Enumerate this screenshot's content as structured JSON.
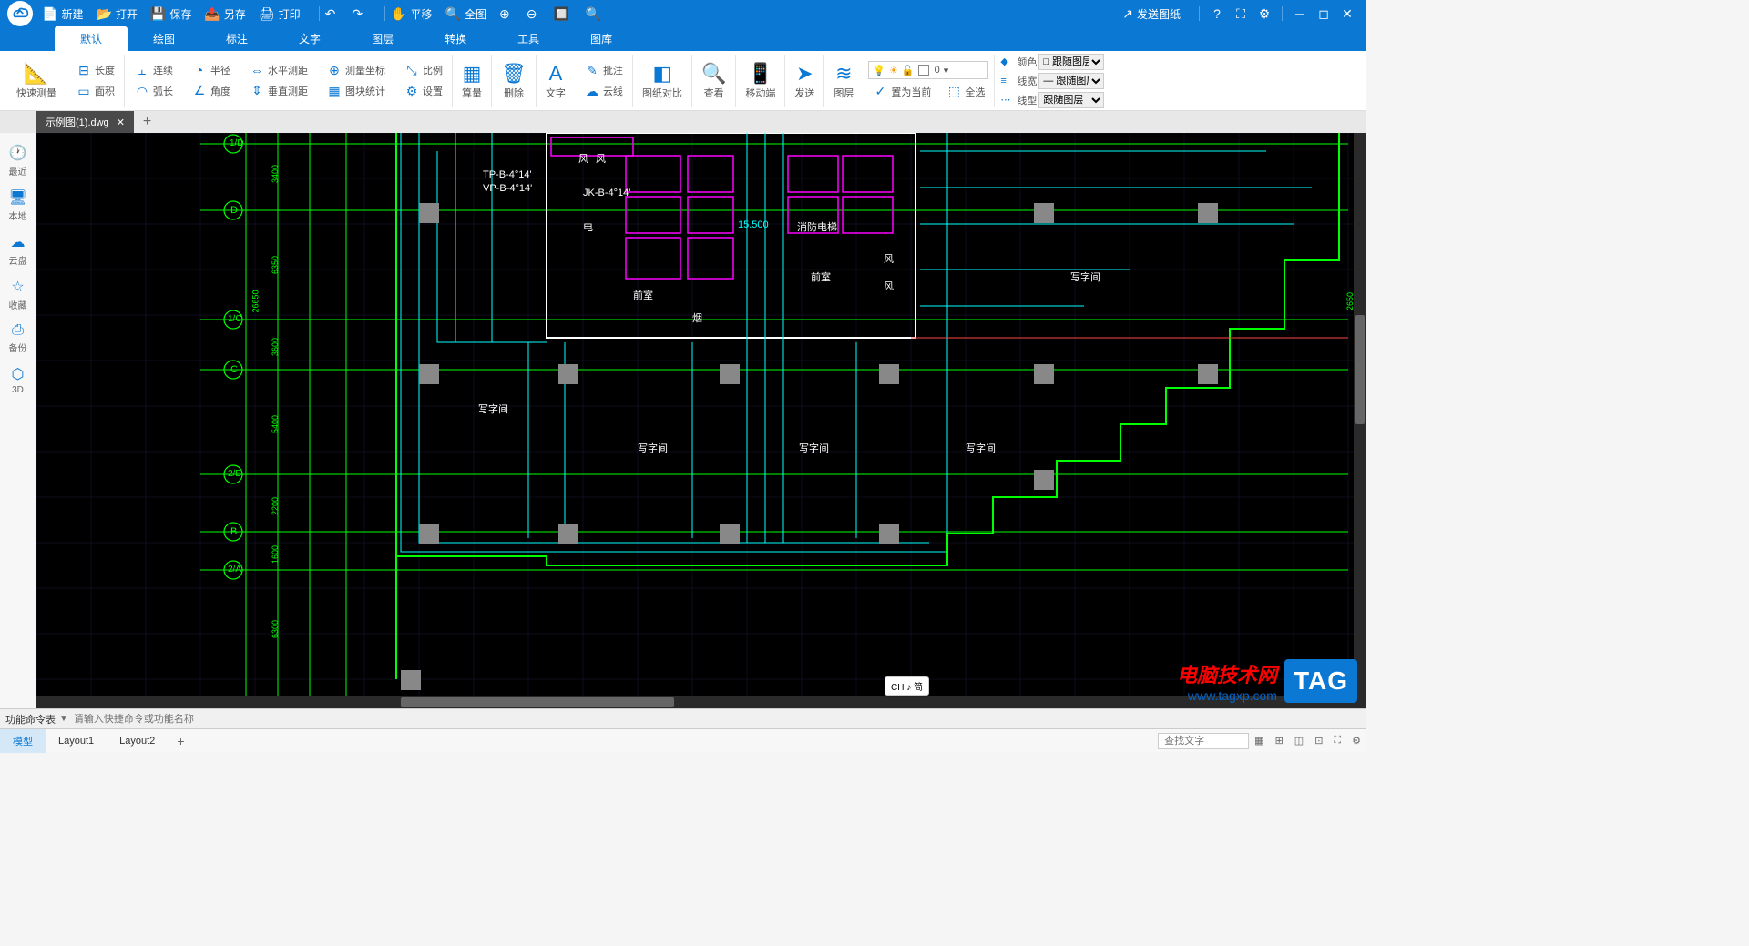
{
  "titlebar": {
    "new": "新建",
    "open": "打开",
    "save": "保存",
    "saveas": "另存",
    "print": "打印",
    "pan": "平移",
    "fit": "全图",
    "send": "发送图纸"
  },
  "menutabs": [
    "默认",
    "绘图",
    "标注",
    "文字",
    "图层",
    "转换",
    "工具",
    "图库"
  ],
  "ribbon": {
    "quickmeasure": "快速测量",
    "length": "长度",
    "area": "面积",
    "continuous": "连续",
    "arc": "弧长",
    "radius": "半径",
    "angle": "角度",
    "hdist": "水平测距",
    "vdist": "垂直测距",
    "coord": "测量坐标",
    "blockstat": "图块统计",
    "scale": "比例",
    "settings": "设置",
    "calc": "算量",
    "delete": "删除",
    "text": "文字",
    "cloud": "云线",
    "annotate": "批注",
    "compare": "图纸对比",
    "view": "查看",
    "mobile": "移动端",
    "send": "发送",
    "layer": "图层",
    "setcurrent": "置为当前",
    "selectall": "全选",
    "color": "颜色",
    "linewidth": "线宽",
    "linetype": "线型",
    "bylayer": "跟随图层",
    "layernum": "0"
  },
  "filetab": "示例图(1).dwg",
  "sidebar": [
    "最近",
    "本地",
    "云盘",
    "收藏",
    "备份",
    "3D"
  ],
  "canvastext": {
    "tp": "TP-B-4°14'",
    "vp": "VP-B-4°14'",
    "jk": "JK-B-4°14'",
    "dian": "电",
    "fire_elev": "消防电梯",
    "qianshi": "前室",
    "yan": "烟",
    "office": "写字间",
    "feng": "风",
    "level": "15.500",
    "axis_d": "D",
    "axis_c": "C",
    "axis_b": "B",
    "axis_1d": "1/D",
    "axis_1c": "1/C",
    "axis_2b": "2/B",
    "axis_2a": "2/A",
    "dim1": "3400",
    "dim2": "6350",
    "dim3": "26650",
    "dim4": "3600",
    "dim5": "5400",
    "dim6": "2200",
    "dim7": "1600",
    "dim8": "6300",
    "dim_right": "2650"
  },
  "ime": "CH ♪ 简",
  "cmdbar": {
    "label": "功能命令表",
    "placeholder": "请输入快捷命令或功能名称"
  },
  "layouttabs": [
    "模型",
    "Layout1",
    "Layout2"
  ],
  "status": {
    "search_placeholder": "查找文字"
  },
  "watermark": {
    "line1": "电脑技术网",
    "line2": "www.tagxp.com",
    "tag": "TAG"
  }
}
